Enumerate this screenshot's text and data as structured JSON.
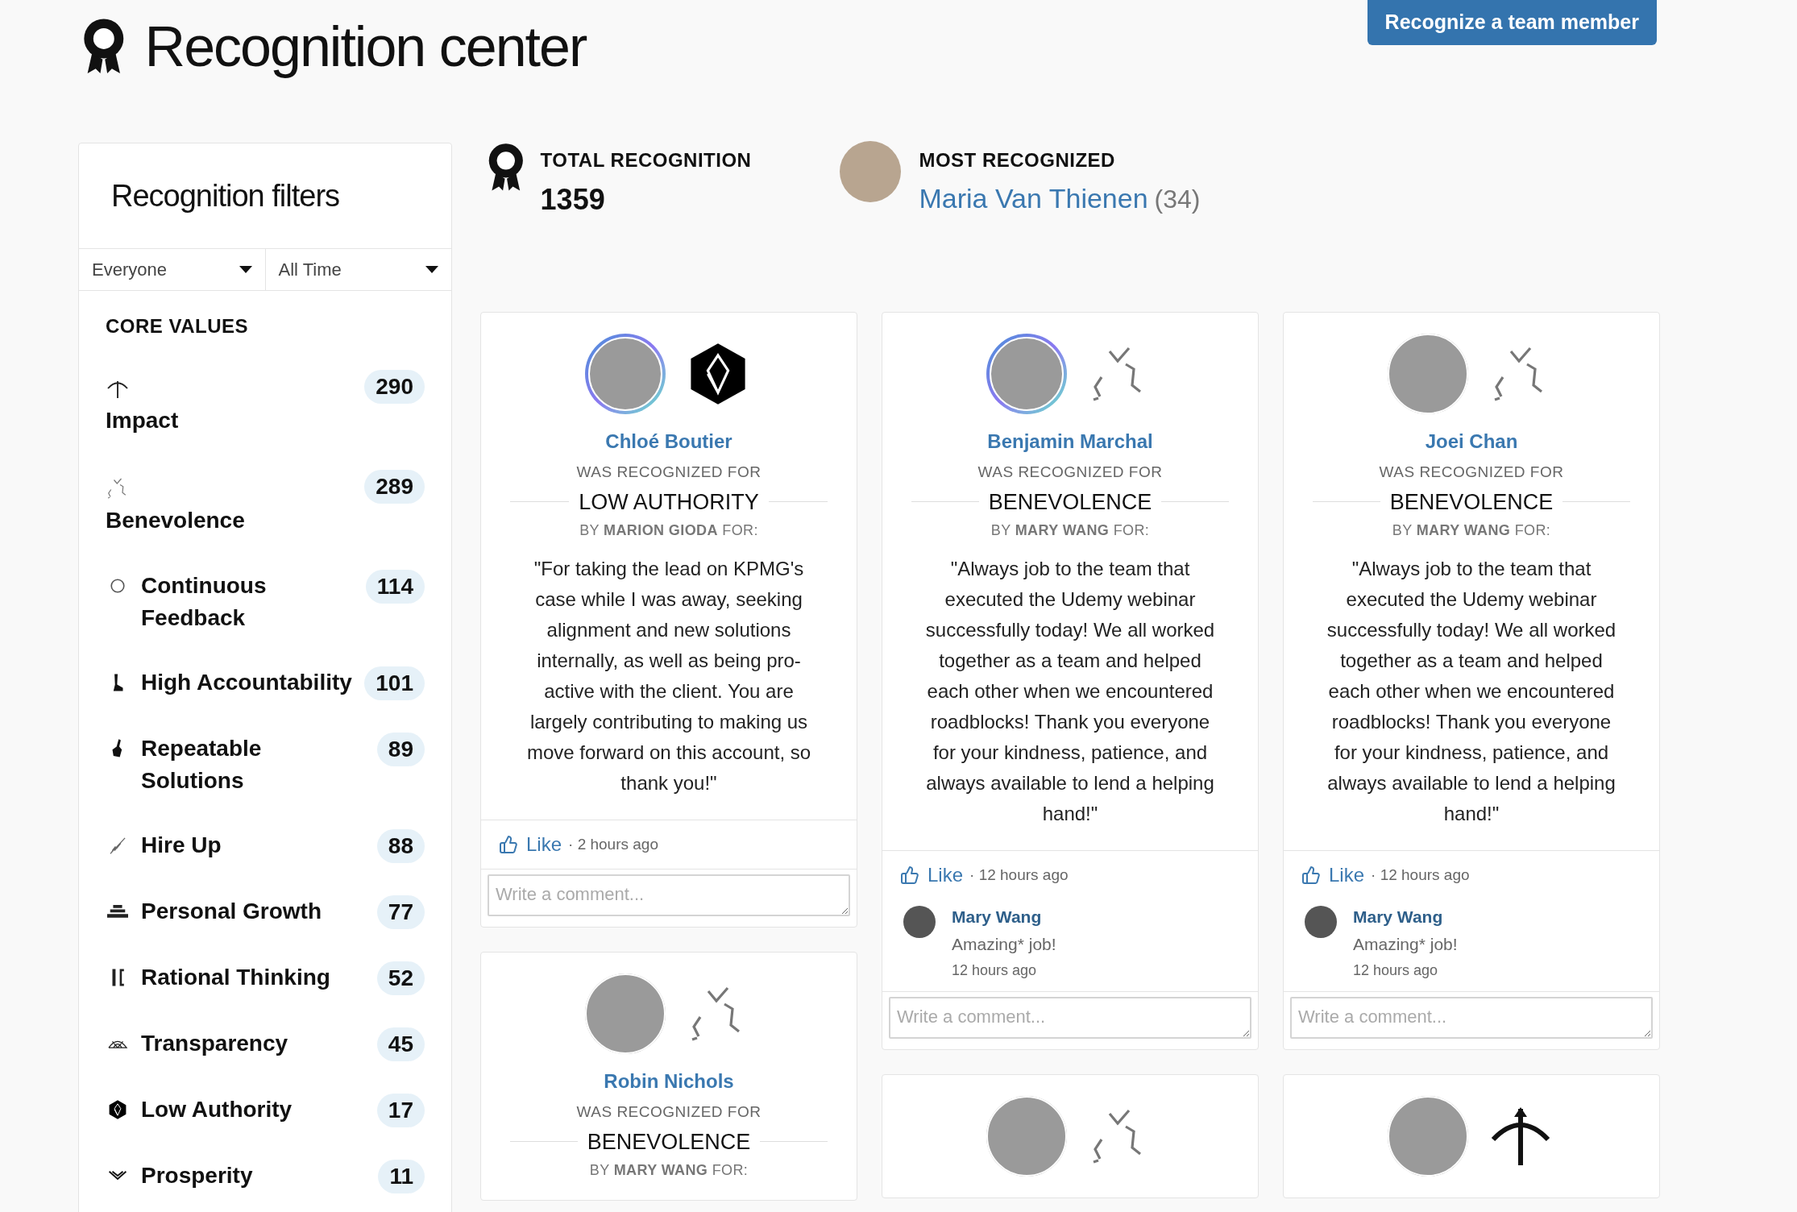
{
  "header": {
    "title": "Recognition center",
    "button": "Recognize a team member"
  },
  "filters": {
    "title": "Recognition filters",
    "dropdowns": [
      {
        "value": "Everyone"
      },
      {
        "value": "All Time"
      }
    ],
    "section": "CORE VALUES",
    "values": [
      {
        "label": "Impact",
        "count": "290",
        "kind": "stacked"
      },
      {
        "label": "Benevolence",
        "count": "289",
        "kind": "stacked"
      },
      {
        "label": "Continuous Feedback",
        "count": "114",
        "kind": "inline"
      },
      {
        "label": "High Accountability",
        "count": "101",
        "kind": "inline"
      },
      {
        "label": "Repeatable Solutions",
        "count": "89",
        "kind": "inline"
      },
      {
        "label": "Hire Up",
        "count": "88",
        "kind": "inline"
      },
      {
        "label": "Personal Growth",
        "count": "77",
        "kind": "inline"
      },
      {
        "label": "Rational Thinking",
        "count": "52",
        "kind": "inline"
      },
      {
        "label": "Transparency",
        "count": "45",
        "kind": "inline"
      },
      {
        "label": "Low Authority",
        "count": "17",
        "kind": "inline"
      },
      {
        "label": "Prosperity",
        "count": "11",
        "kind": "inline"
      }
    ]
  },
  "stats": {
    "total": {
      "label": "TOTAL RECOGNITION",
      "value": "1359"
    },
    "most": {
      "label": "MOST RECOGNIZED",
      "name": "Maria Van Thienen",
      "count": "(34)"
    }
  },
  "columns": [
    {
      "cards": [
        {
          "avatar_ring": true,
          "name": "Chloé Boutier",
          "caption": "WAS RECOGNIZED FOR",
          "value": "LOW AUTHORITY",
          "by": "BY **MARION GIODA** FOR:",
          "message": "\"For taking the lead on KPMG's case while I was away, seeking alignment and new solutions internally, as well as being pro-active with the client. You are largely contributing to making us move forward on this account, so thank you!\"",
          "like": "Like",
          "time": "· 2 hours ago",
          "placeholder": "Write a comment..."
        },
        {
          "avatar_ring": false,
          "name": "Robin Nichols",
          "caption": "WAS RECOGNIZED FOR",
          "value": "BENEVOLENCE",
          "by": "BY **MARY WANG** FOR:"
        }
      ]
    },
    {
      "cards": [
        {
          "avatar_ring": true,
          "name": "Benjamin Marchal",
          "caption": "WAS RECOGNIZED FOR",
          "value": "BENEVOLENCE",
          "by": "BY **MARY WANG** FOR:",
          "message": "\"Always job to the team that executed the Udemy webinar successfully today! We all worked together as a team and helped each other when we encountered roadblocks! Thank you everyone for your kindness, patience, and always available to lend a helping hand!\"",
          "like": "Like",
          "time": "· 12 hours ago",
          "comments": [
            {
              "author": "Mary Wang",
              "text": "Amazing* job!",
              "time": "12 hours ago"
            }
          ],
          "placeholder": "Write a comment..."
        },
        {
          "avatar_ring": false
        }
      ]
    },
    {
      "cards": [
        {
          "avatar_ring": false,
          "name": "Joei Chan",
          "caption": "WAS RECOGNIZED FOR",
          "value": "BENEVOLENCE",
          "by": "BY **MARY WANG** FOR:",
          "message": "\"Always job to the team that executed the Udemy webinar successfully today! We all worked together as a team and helped each other when we encountered roadblocks! Thank you everyone for your kindness, patience, and always available to lend a helping hand!\"",
          "like": "Like",
          "time": "· 12 hours ago",
          "comments": [
            {
              "author": "Mary Wang",
              "text": "Amazing* job!",
              "time": "12 hours ago"
            }
          ],
          "placeholder": "Write a comment..."
        },
        {
          "avatar_ring": false
        }
      ]
    }
  ]
}
